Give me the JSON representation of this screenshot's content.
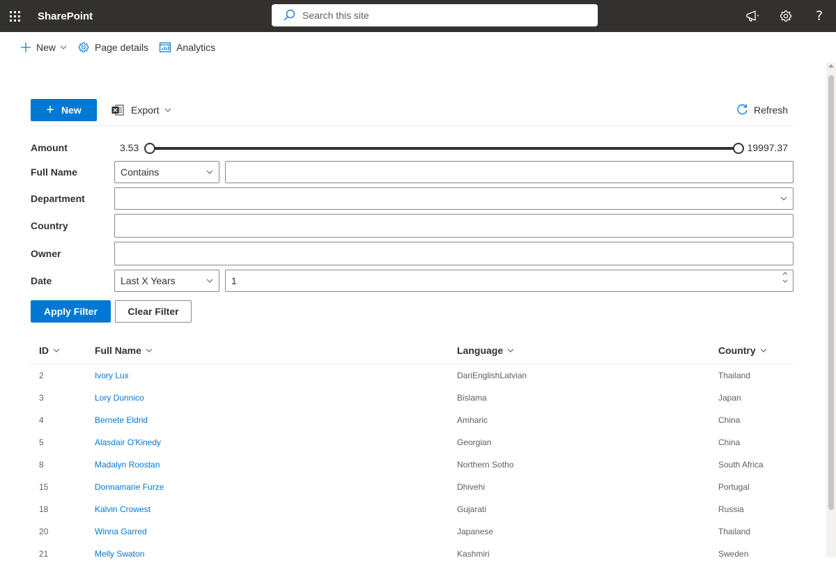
{
  "suite": {
    "app_name": "SharePoint",
    "search_placeholder": "Search this site"
  },
  "commandbar": {
    "new_label": "New",
    "page_details_label": "Page details",
    "analytics_label": "Analytics"
  },
  "toolbar": {
    "new_label": "New",
    "export_label": "Export",
    "refresh_label": "Refresh"
  },
  "filters": {
    "amount_label": "Amount",
    "amount_min": "3.53",
    "amount_max": "19997.37",
    "full_name_label": "Full Name",
    "full_name_operator": "Contains",
    "full_name_value": "",
    "department_label": "Department",
    "department_value": "",
    "country_label": "Country",
    "country_value": "",
    "owner_label": "Owner",
    "owner_value": "",
    "date_label": "Date",
    "date_operator": "Last X Years",
    "date_value": "1",
    "apply_label": "Apply Filter",
    "clear_label": "Clear Filter"
  },
  "table": {
    "headers": {
      "id": "ID",
      "full_name": "Full Name",
      "language": "Language",
      "country": "Country"
    },
    "rows": [
      {
        "id": "2",
        "name": "Ivory Lux",
        "language": "DariEnglishLatvian",
        "country": "Thailand"
      },
      {
        "id": "3",
        "name": "Lory Dunnico",
        "language": "Bislama",
        "country": "Japan"
      },
      {
        "id": "4",
        "name": "Bernete Eldrid",
        "language": "Amharic",
        "country": "China"
      },
      {
        "id": "5",
        "name": "Alasdair O'Kinedy",
        "language": "Georgian",
        "country": "China"
      },
      {
        "id": "8",
        "name": "Madalyn Roostan",
        "language": "Northern Sotho",
        "country": "South Africa"
      },
      {
        "id": "15",
        "name": "Donnamarie Furze",
        "language": "Dhivehi",
        "country": "Portugal"
      },
      {
        "id": "18",
        "name": "Kalvin Crowest",
        "language": "Gujarati",
        "country": "Russia"
      },
      {
        "id": "20",
        "name": "Winna Garred",
        "language": "Japanese",
        "country": "Thailand"
      },
      {
        "id": "21",
        "name": "Melly Swaton",
        "language": "Kashmiri",
        "country": "Sweden"
      }
    ]
  },
  "colors": {
    "suitebar": "#323130",
    "accent": "#0078d4",
    "text": "#323130",
    "muted": "#605e5c"
  }
}
